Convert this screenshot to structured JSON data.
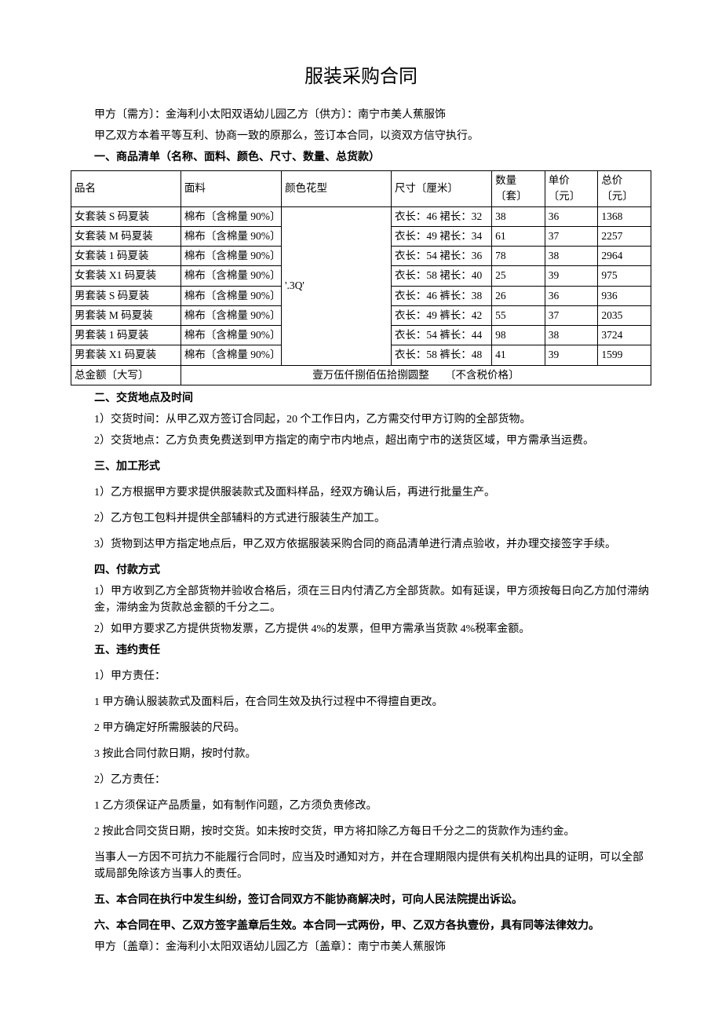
{
  "title": "服装采购合同",
  "parties": "甲方〔需方〕：金海利小太阳双语幼儿园乙方〔供方〕：南宁市美人蕉服饰",
  "preamble": "甲乙双方本着平等互利、协商一致的原那么，签订本合同，以资双方信守执行。",
  "section1": {
    "heading": "一、商品清单（名称、面料、颜色、尺寸、数量、总货款）",
    "headers": [
      "品名",
      "面料",
      "颜色花型",
      "尺寸〔厘米〕",
      "数量〔套〕",
      "单价〔元〕",
      "总价〔元〕"
    ],
    "pattern": "'.3Q'",
    "rows": [
      {
        "name": "女套装 S 码夏装",
        "material": "棉布〔含棉量 90%〕",
        "size": "衣长：46 裙长：32",
        "qty": "38",
        "price": "36",
        "total": "1368"
      },
      {
        "name": "女套装 M 码夏装",
        "material": "棉布〔含棉量 90%〕",
        "size": "衣长：49 裙长：34",
        "qty": "61",
        "price": "37",
        "total": "2257"
      },
      {
        "name": "女套装 1 码夏装",
        "material": "棉布〔含棉量 90%〕",
        "size": "衣长：54 裙长：36",
        "qty": "78",
        "price": "38",
        "total": "2964"
      },
      {
        "name": "女套装 X1 码夏装",
        "material": "棉布〔含棉量 90%〕",
        "size": "衣长：58 裙长：40",
        "qty": "25",
        "price": "39",
        "total": "975"
      },
      {
        "name": "男套装 S 码夏装",
        "material": "棉布〔含棉量 90%〕",
        "size": "衣长：46 裤长：38",
        "qty": "26",
        "price": "36",
        "total": "936"
      },
      {
        "name": "男套装 M 码夏装",
        "material": "棉布〔含棉量 90%〕",
        "size": "衣长：49 裤长：42",
        "qty": "55",
        "price": "37",
        "total": "2035"
      },
      {
        "name": "男套装 1 码夏装",
        "material": "棉布〔含棉量 90%〕",
        "size": "衣长：54 裤长：44",
        "qty": "98",
        "price": "38",
        "total": "3724"
      },
      {
        "name": "男套装 X1 码夏装",
        "material": "棉布〔含棉量 90%〕",
        "size": "衣长：58 裤长：48",
        "qty": "41",
        "price": "39",
        "total": "1599"
      }
    ],
    "totalLabel": "总金额〔大写〕",
    "totalText": "壹万伍仟捌佰伍拾捌圆整",
    "totalNote": "〔不含税价格〕"
  },
  "section2": {
    "heading": "二、交货地点及时间",
    "p1": "1）交货时间：从甲乙双方签订合同起，20 个工作日内，乙方需交付甲方订购的全部货物。",
    "p2": "2）交货地点：乙方负责免费送到甲方指定的南宁市内地点，超出南宁市的送货区域，甲方需承当运费。"
  },
  "section3": {
    "heading": "三、加工形式",
    "p1": "1）乙方根据甲方要求提供服装款式及面料样品，经双方确认后，再进行批量生产。",
    "p2": "2）乙方包工包料并提供全部辅料的方式进行服装生产加工。",
    "p3": "3）货物到达甲方指定地点后，甲乙双方依据服装采购合同的商品清单进行清点验收，并办理交接签字手续。"
  },
  "section4": {
    "heading": "四、付款方式",
    "p1": "1）甲方收到乙方全部货物并验收合格后，须在三日内付清乙方全部货款。如有延误，甲方须按每日向乙方加付滞纳金，滞纳金为货款总金额的千分之二。",
    "p2": "2）如甲方要求乙方提供货物发票，乙方提供 4%的发票，但甲方需承当货款 4%税率金额。"
  },
  "section5": {
    "heading": "五、违约责任",
    "p1": "1）甲方责任：",
    "p1a": "1 甲方确认服装款式及面料后，在合同生效及执行过程中不得擅自更改。",
    "p1b": "2 甲方确定好所需服装的尺码。",
    "p1c": "3 按此合同付款日期，按时付款。",
    "p2": "2）乙方责任：",
    "p2a": "1 乙方须保证产品质量，如有制作问题，乙方须负责修改。",
    "p2b": "2 按此合同交货日期，按时交货。如未按时交货，甲方将扣除乙方每日千分之二的货款作为违约金。",
    "p3": "当事人一方因不可抗力不能履行合同时，应当及时通知对方，并在合理期限内提供有关机构出具的证明，可以全部或局部免除该方当事人的责任。"
  },
  "section6": "五、本合同在执行中发生纠纷，签订合同双方不能协商解决时，可向人民法院提出诉讼。",
  "section7": "六、本合同在甲、乙双方签字盖章后生效。本合同一式两份，甲、乙双方各执壹份，具有同等法律效力。",
  "signatures": "甲方〔盖章〕：金海利小太阳双语幼儿园乙方〔盖章〕：南宁市美人蕉服饰"
}
